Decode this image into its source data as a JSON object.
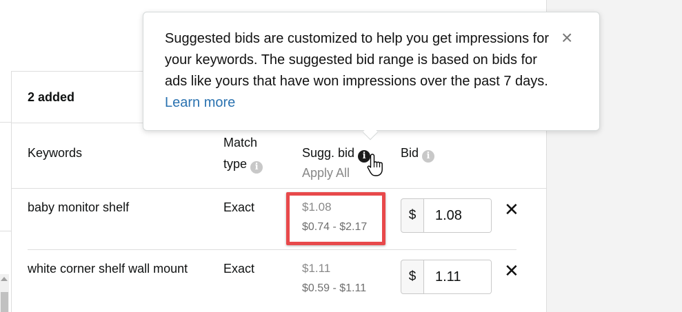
{
  "panel": {
    "added_count": "2 added"
  },
  "columns": {
    "keywords": "Keywords",
    "match_type_line1": "Match",
    "match_type_line2": "type",
    "sugg_bid": "Sugg. bid",
    "apply_all": "Apply All",
    "bid": "Bid"
  },
  "rows": [
    {
      "keyword": "baby monitor shelf",
      "match_type": "Exact",
      "sugg_bid": "$1.08",
      "range": "$0.74 - $2.17",
      "currency": "$",
      "bid": "1.08",
      "remove": "✕"
    },
    {
      "keyword": "white corner shelf wall mount",
      "match_type": "Exact",
      "sugg_bid": "$1.11",
      "range": "$0.59 - $1.11",
      "currency": "$",
      "bid": "1.11",
      "remove": "✕"
    }
  ],
  "popover": {
    "text": "Suggested bids are customized to help you get impressions for your keywords. The suggested bid range is based on bids for ads like yours that have won impressions over the past 7 days.",
    "link": "Learn more",
    "close": "×"
  },
  "icons": {
    "info": "i"
  },
  "colors": {
    "highlight": "#e8494b",
    "link": "#2a72b0"
  }
}
